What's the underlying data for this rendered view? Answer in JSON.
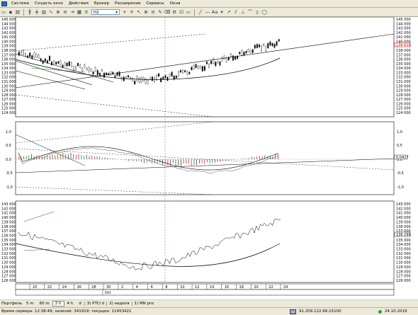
{
  "menubar": {
    "items": [
      "Система",
      "Создать окно",
      "Действия",
      "Брокер",
      "Расширения",
      "Сервисы",
      "Окна"
    ]
  },
  "toolbar": {
    "timeframe": "H2",
    "icons": [
      "open-icon",
      "save-icon",
      "print-icon",
      "text-tool-icon",
      "crosshair-icon",
      "move-icon",
      "cursor-icon",
      "zoom-in-icon",
      "zoom-out-icon",
      "properties-icon",
      "pencil-icon",
      "rectangle-icon",
      "ellipse-icon",
      "triangle-icon",
      "trendline-icon",
      "text-label-icon",
      "arrow-icon",
      "fibo-icon"
    ]
  },
  "axis": {
    "price_ticks": [
      "145 000",
      "144 000",
      "143 000",
      "142 000",
      "141 000",
      "140 000",
      "139 000",
      "138 000",
      "137 000",
      "136 000",
      "135 000",
      "134 000",
      "133 000",
      "132 000",
      "131 000",
      "130 000",
      "129 000",
      "128 000",
      "127 000",
      "126 000",
      "125 000",
      "124 000"
    ],
    "osc_ticks": [
      "1,0",
      "0,5",
      "0,0",
      "-0,5",
      "-1,0"
    ],
    "osc_current": "0,0427",
    "price_current": "139 610",
    "lower_current": "136 299",
    "lower_ticks": [
      "143 000",
      "142 000",
      "141 000",
      "140 000",
      "139 000",
      "138 000",
      "137 000",
      "136 000",
      "135 000",
      "134 000",
      "133 000",
      "132 000",
      "131 000",
      "130 000",
      "129 000",
      "128 000",
      "127 000",
      "126 000"
    ],
    "date_ticks": [
      "20",
      "22",
      "24",
      "26",
      "28",
      "30",
      "2",
      "4",
      "6",
      "8",
      "10",
      "12",
      "14",
      "16",
      "18",
      "20",
      "22",
      "24"
    ],
    "month_label": "Oct"
  },
  "status": {
    "portfolio_label": "Портфель",
    "timeframes": [
      "5 m",
      "60 m",
      "2 h",
      "4 h",
      "d"
    ],
    "active_timeframe": "2 h",
    "tabs": [
      "3) PTCI d",
      "2) неделя",
      "1) MN рпс"
    ],
    "server_time": "Время сервера: 12:38:49; записей: 341919; текущих: 11453421",
    "ip": "91.209.122.66:15100",
    "date": "24.10.2019"
  }
}
